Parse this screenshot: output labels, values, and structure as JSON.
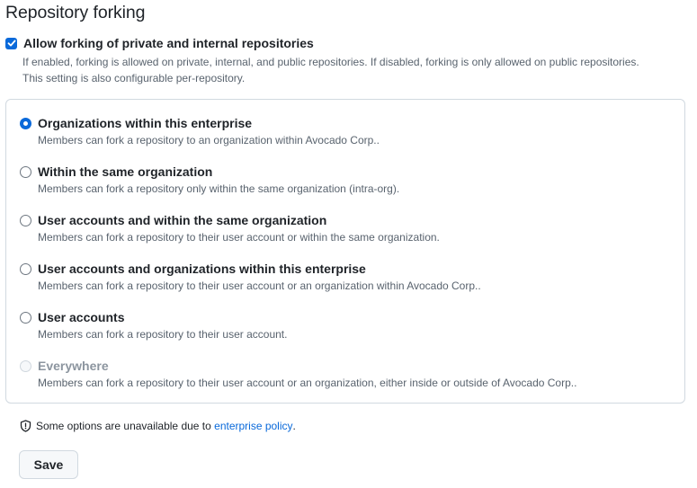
{
  "section": {
    "title": "Repository forking"
  },
  "allow_forking": {
    "checked": true,
    "label": "Allow forking of private and internal repositories",
    "description_line1": "If enabled, forking is allowed on private, internal, and public repositories. If disabled, forking is only allowed on public repositories.",
    "description_line2": "This setting is also configurable per-repository."
  },
  "options": [
    {
      "label": "Organizations within this enterprise",
      "description": "Members can fork a repository to an organization within Avocado Corp..",
      "selected": true,
      "disabled": false
    },
    {
      "label": "Within the same organization",
      "description": "Members can fork a repository only within the same organization (intra-org).",
      "selected": false,
      "disabled": false
    },
    {
      "label": "User accounts and within the same organization",
      "description": "Members can fork a repository to their user account or within the same organization.",
      "selected": false,
      "disabled": false
    },
    {
      "label": "User accounts and organizations within this enterprise",
      "description": "Members can fork a repository to their user account or an organization within Avocado Corp..",
      "selected": false,
      "disabled": false
    },
    {
      "label": "User accounts",
      "description": "Members can fork a repository to their user account.",
      "selected": false,
      "disabled": false
    },
    {
      "label": "Everywhere",
      "description": "Members can fork a repository to their user account or an organization, either inside or outside of Avocado Corp..",
      "selected": false,
      "disabled": true
    }
  ],
  "notice": {
    "icon": "shield-icon",
    "text": "Some options are unavailable due to ",
    "link_text": "enterprise policy",
    "suffix": "."
  },
  "save_button": {
    "label": "Save"
  },
  "colors": {
    "accent": "#0969da",
    "border": "#d1d9e0",
    "muted_text": "#59636e"
  }
}
